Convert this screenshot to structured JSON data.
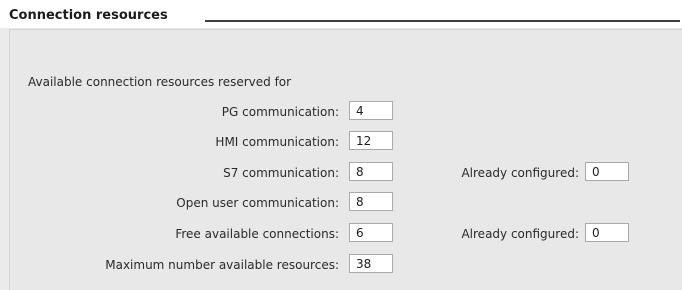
{
  "section": {
    "title": "Connection resources"
  },
  "intro_text": "Available connection resources reserved for",
  "rows": [
    {
      "label": "PG communication:",
      "value": "4"
    },
    {
      "label": "HMI communication:",
      "value": "12"
    },
    {
      "label": "S7 communication:",
      "value": "8",
      "extra_label": "Already configured:",
      "extra_value": "0"
    },
    {
      "label": "Open user communication:",
      "value": "8"
    },
    {
      "label": "Free available connections:",
      "value": "6",
      "extra_label": "Already configured:",
      "extra_value": "0"
    },
    {
      "label": "Maximum number available resources:",
      "value": "38"
    }
  ]
}
